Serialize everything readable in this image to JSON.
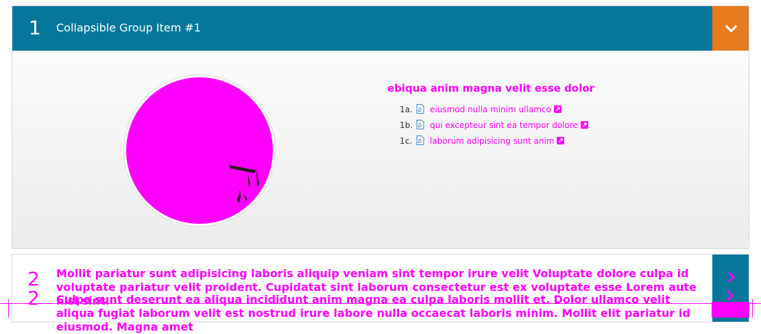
{
  "panel1": {
    "number": "1",
    "title": "Collapsible Group Item #1",
    "toggle_icon": "chevron-down-icon",
    "content_title": "ebiqua anim magna velit esse dolor",
    "documents": [
      {
        "num": "1a.",
        "label": "eiusmod nulla minim ullamco"
      },
      {
        "num": "1b.",
        "label": "qui excepteur sint ea tempor dolore"
      },
      {
        "num": "1c.",
        "label": "laborum adipisicing sunt anim"
      }
    ],
    "colors": {
      "header": "#06779a",
      "toggle": "#e87a20",
      "accent": "#ff00ff"
    }
  },
  "panel2": {
    "number": "2",
    "body": "Mollit pariatur sunt adipisicing laboris aliquip veniam sint tempor irure velit Voluptate dolore culpa id voluptate pariatur velit proident. Cupidatat sint laborum consectetur est ex voluptate esse Lorem aute nisi sint.",
    "toggle_icon": "chevron-right-icon"
  },
  "panel3": {
    "number": "2",
    "body": "Culpa sunt deserunt ea aliqua incididunt anim magna ea culpa laboris mollit et. Dolor ullamco velit aliqua fugiat laborum velit est nostrud irure labore nulla occaecat laboris minim. Mollit elit pariatur id eiusmod. Magna amet",
    "toggle_icon": "chevron-right-icon"
  }
}
